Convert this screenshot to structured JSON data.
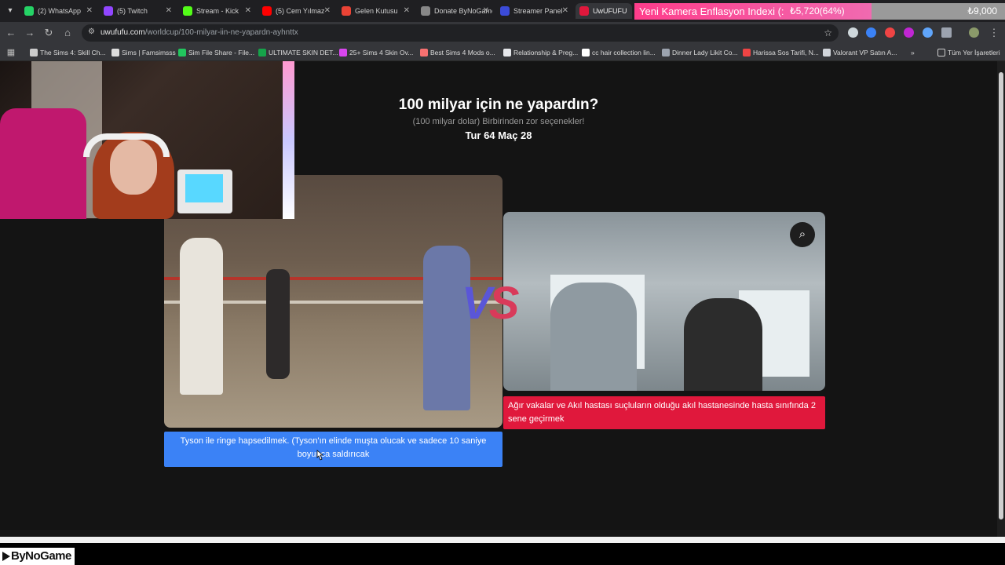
{
  "tabs": [
    {
      "label": "(2) WhatsApp",
      "color": "#25d366"
    },
    {
      "label": "(5) Twitch",
      "color": "#9146ff"
    },
    {
      "label": "Stream - Kick",
      "color": "#53fc18"
    },
    {
      "label": "(5) Cem Yılmaz",
      "color": "#ff0000"
    },
    {
      "label": "Gelen Kutusu",
      "color": "#ea4335"
    },
    {
      "label": "Donate ByNoGame",
      "color": "#888888"
    },
    {
      "label": "Streamer Panel",
      "color": "#3b4bd8"
    },
    {
      "label": "UwUFUFU",
      "color": "#e0183c"
    }
  ],
  "ticker": {
    "label": "Yeni Kamera Enflasyon Indexi (:",
    "current": "₺5,720(64%)",
    "goal": "₺9,000",
    "progress_percent": 64
  },
  "address": {
    "domain": "uwufufu.com",
    "path": "/worldcup/100-milyar-iin-ne-yapardn-ayhnttx"
  },
  "bookmarks": [
    {
      "label": "The Sims 4: Skill Ch...",
      "color": "#cccccc"
    },
    {
      "label": "Sims | Famsimsss",
      "color": "#dddddd"
    },
    {
      "label": "Sim File Share - File...",
      "color": "#22c55e"
    },
    {
      "label": "ULTIMATE SKIN DET...",
      "color": "#16a34a"
    },
    {
      "label": "25+ Sims 4 Skin Ov...",
      "color": "#d946ef"
    },
    {
      "label": "Best Sims 4 Mods o...",
      "color": "#f87171"
    },
    {
      "label": "Relationship & Preg...",
      "color": "#e5e7eb"
    },
    {
      "label": "cc hair collection lin...",
      "color": "#ffffff"
    },
    {
      "label": "Dinner Lady Likit Co...",
      "color": "#9ca3af"
    },
    {
      "label": "Harissa Sos Tarifi, N...",
      "color": "#ef4444"
    },
    {
      "label": "Valorant VP Satın A...",
      "color": "#d1d5db"
    }
  ],
  "bookmarks_all": "Tüm Yer İşaretleri",
  "page": {
    "title": "100 milyar için ne yapardın?",
    "subtitle": "(100 milyar dolar) Birbirinden zor seçenekler!",
    "round": "Tur 64 Maç 28",
    "vs": {
      "v": "V",
      "s": "S"
    },
    "left_caption": "Tyson ile ringe hapsedilmek. (Tyson'ın elinde muşta olucak ve sadece 10 saniye boyunca saldırıcak",
    "right_caption": "Ağır vakalar ve Akıl hastası suçluların olduğu akıl hastanesinde hasta sınıfında 2 sene geçirmek"
  },
  "overlay": {
    "logo": "ByNoGame"
  }
}
